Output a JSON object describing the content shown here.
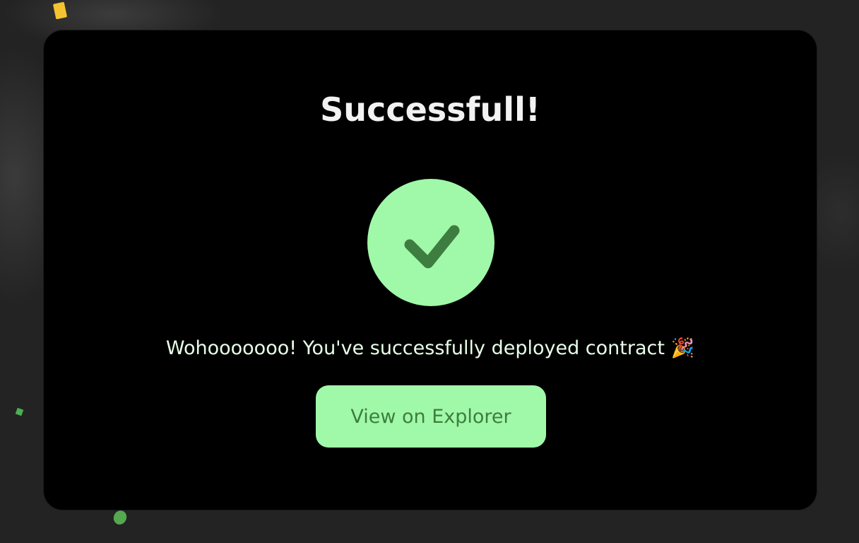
{
  "modal": {
    "title": "Successfull!",
    "status_icon": "checkmark-icon",
    "message": "Wohooooooo! You've successfully deployed contract 🎉",
    "button_label": "View on Explorer"
  },
  "colors": {
    "accent": "#a0f9a8",
    "accent_dark": "#3e7d40",
    "modal_background": "#000000",
    "page_background": "#232323",
    "title_text": "#f2f2f2",
    "message_text": "#e8ffe8"
  }
}
